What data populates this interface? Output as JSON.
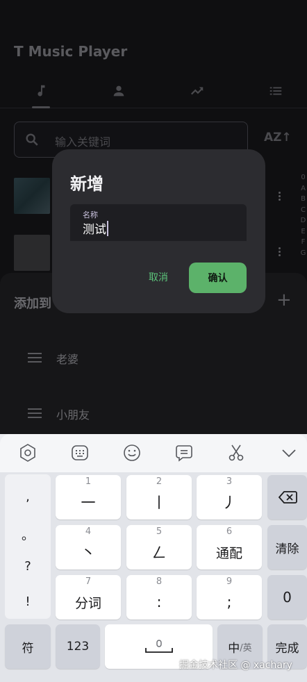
{
  "app": {
    "title": "T Music Player"
  },
  "tabs": [
    {
      "icon": "music-note-icon"
    },
    {
      "icon": "person-icon"
    },
    {
      "icon": "trending-icon"
    },
    {
      "icon": "list-icon"
    }
  ],
  "search": {
    "placeholder": "输入关键词",
    "sort_label": "AZ↑"
  },
  "alpha_index": [
    "0",
    "A",
    "B",
    "C",
    "D",
    "E",
    "F",
    "G"
  ],
  "sheet": {
    "title": "添加到",
    "add_label": "+",
    "playlists": [
      {
        "label": "老婆"
      },
      {
        "label": "小朋友"
      }
    ]
  },
  "dialog": {
    "title": "新增",
    "field_label": "名称",
    "field_value": "测试",
    "cancel_label": "取消",
    "confirm_label": "确认"
  },
  "keyboard": {
    "toolbar": [
      "settings-hexagon-icon",
      "keyboard-icon",
      "emoji-icon",
      "clipboard-icon",
      "scissors-icon",
      "chevron-down-icon"
    ],
    "punct": [
      ",",
      "。",
      "?",
      "!"
    ],
    "keys": [
      {
        "num": "1",
        "main": "一"
      },
      {
        "num": "2",
        "main": "丨"
      },
      {
        "num": "3",
        "main": "丿"
      },
      {
        "num": "4",
        "main": "丶"
      },
      {
        "num": "5",
        "main": "ㄥ"
      },
      {
        "num": "6",
        "main": "通配"
      },
      {
        "num": "7",
        "main": "分词"
      },
      {
        "num": "8",
        "main": ":"
      },
      {
        "num": "9",
        "main": ";"
      }
    ],
    "clear_label": "清除",
    "zero_label": "0",
    "symbol_label": "符",
    "numbers_label": "123",
    "lang_main": "中",
    "lang_alt": "/英",
    "done_label": "完成"
  },
  "watermark": "掘金技术社区 @ xachary",
  "colors": {
    "accent": "#5cb26a",
    "dialog_bg": "#2c2c30"
  }
}
